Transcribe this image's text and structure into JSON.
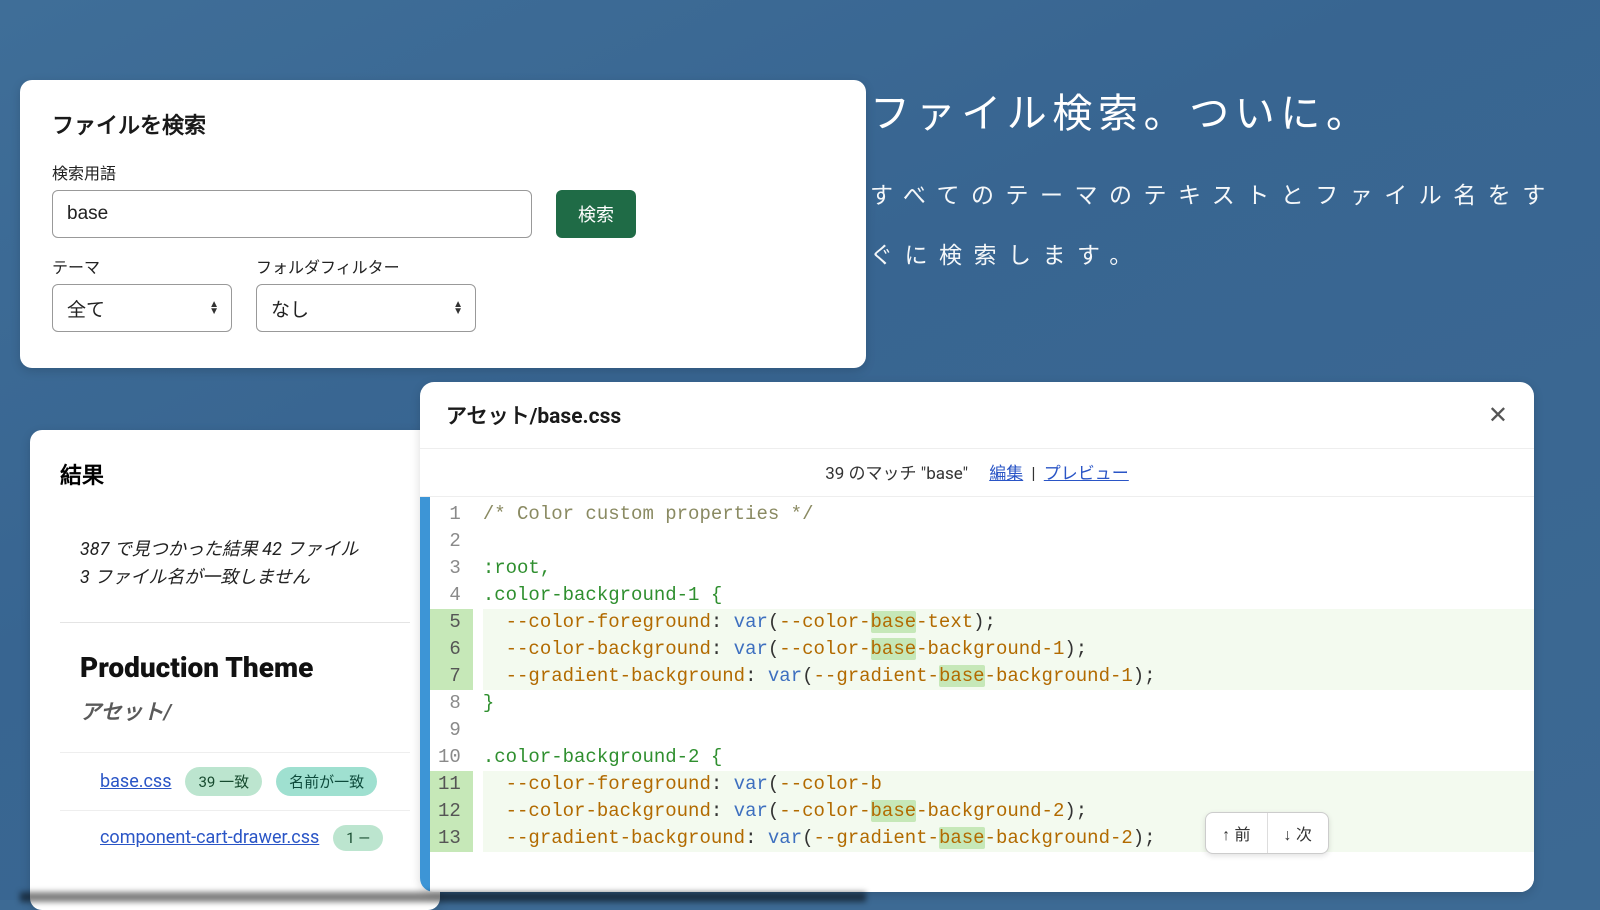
{
  "marketing": {
    "title": "ファイル検索。ついに。",
    "subtitle": "すべてのテーマのテキストとファイル名をすぐに検索します。"
  },
  "search": {
    "panel_title": "ファイルを検索",
    "term_label": "検索用語",
    "term_value": "base",
    "search_button": "検索",
    "theme_label": "テーマ",
    "theme_value": "全て",
    "folder_label": "フォルダフィルター",
    "folder_value": "なし"
  },
  "results": {
    "title": "結果",
    "summary_line1": "387 で見つかった結果 42 ファイル",
    "summary_line2": "3 ファイル名が一致しません",
    "theme_heading": "Production Theme",
    "folder_heading": "アセット/",
    "files": [
      {
        "name": "base.css",
        "match_badge": "39 一致",
        "name_badge": "名前が一致"
      },
      {
        "name": "component-cart-drawer.css",
        "match_badge": "1 —"
      }
    ]
  },
  "code": {
    "title": "アセット/base.css",
    "match_text": "39 のマッチ \"base\"",
    "edit_link": "編集",
    "preview_link": "プレビュー",
    "lines": [
      {
        "n": 1,
        "hl": false,
        "raw": "/* Color custom properties */",
        "kind": "cmt"
      },
      {
        "n": 2,
        "hl": false,
        "raw": "",
        "kind": ""
      },
      {
        "n": 3,
        "hl": false,
        "raw": ":root,",
        "kind": "sel"
      },
      {
        "n": 4,
        "hl": false,
        "raw": ".color-background-1 {",
        "kind": "sel"
      },
      {
        "n": 5,
        "hl": true,
        "prop": "--color-foreground",
        "val": "var(--color-|base|-text)"
      },
      {
        "n": 6,
        "hl": true,
        "prop": "--color-background",
        "val": "var(--color-|base|-background-1)"
      },
      {
        "n": 7,
        "hl": true,
        "prop": "--gradient-background",
        "val": "var(--gradient-|base|-background-1)"
      },
      {
        "n": 8,
        "hl": false,
        "raw": "}",
        "kind": "brace"
      },
      {
        "n": 9,
        "hl": false,
        "raw": "",
        "kind": ""
      },
      {
        "n": 10,
        "hl": false,
        "raw": ".color-background-2 {",
        "kind": "sel"
      },
      {
        "n": 11,
        "hl": true,
        "prop": "--color-foreground",
        "val": "var(--color-b"
      },
      {
        "n": 12,
        "hl": true,
        "prop": "--color-background",
        "val": "var(--color-|base|-background-2)"
      },
      {
        "n": 13,
        "hl": true,
        "prop": "--gradient-background",
        "val": "var(--gradient-|base|-background-2)"
      }
    ],
    "nav_prev": "↑ 前",
    "nav_next": "↓ 次"
  }
}
